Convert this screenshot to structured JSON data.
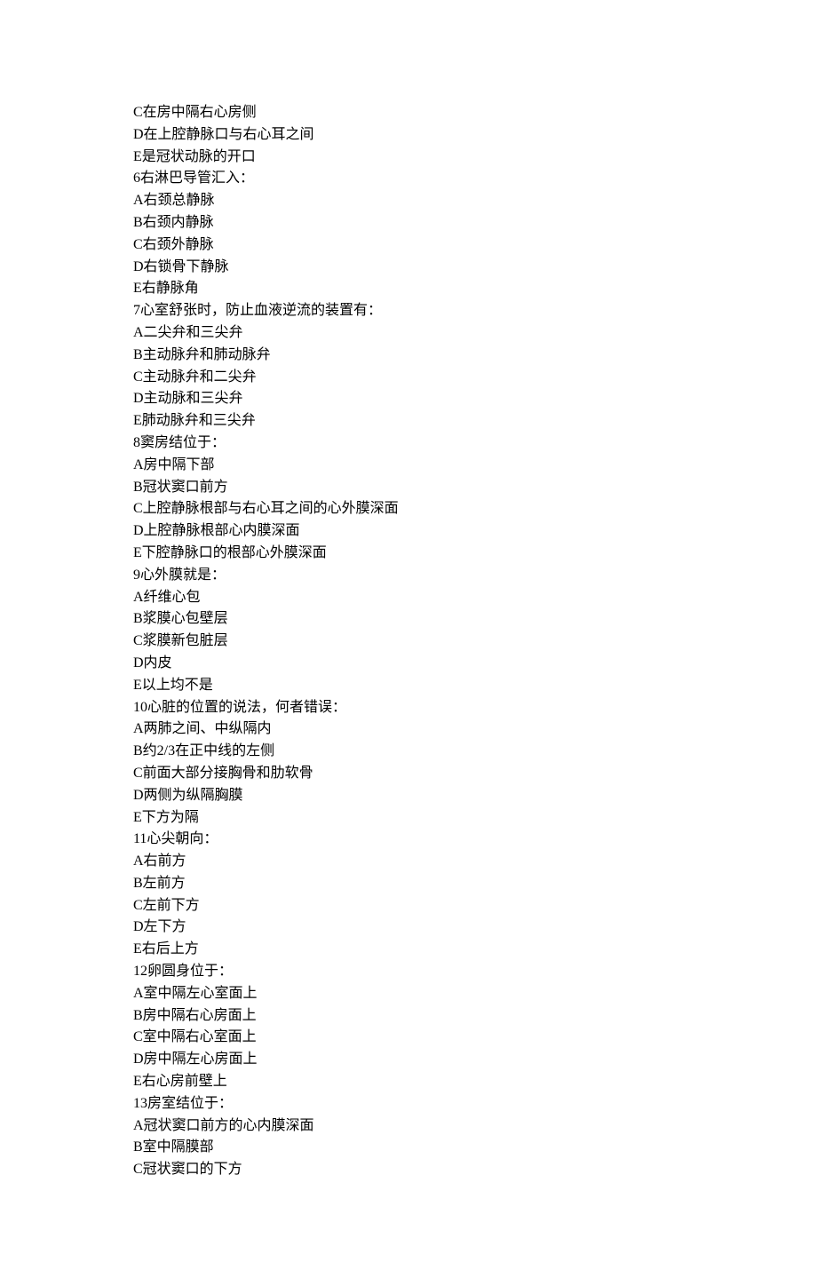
{
  "lines": [
    "C在房中隔右心房侧",
    "D在上腔静脉口与右心耳之间",
    "E是冠状动脉的开口",
    "6右淋巴导管汇入：",
    "A右颈总静脉",
    "B右颈内静脉",
    "C右颈外静脉",
    "D右锁骨下静脉",
    "E右静脉角",
    "7心室舒张时，防止血液逆流的装置有：",
    "A二尖弁和三尖弁",
    "B主动脉弁和肺动脉弁",
    "C主动脉弁和二尖弁",
    "D主动脉和三尖弁",
    "E肺动脉弁和三尖弁",
    "8窦房结位于：",
    "A房中隔下部",
    "B冠状窦口前方",
    "C上腔静脉根部与右心耳之间的心外膜深面",
    "D上腔静脉根部心内膜深面",
    "E下腔静脉口的根部心外膜深面",
    "9心外膜就是：",
    "A纤维心包",
    "B浆膜心包壁层",
    "C浆膜新包脏层",
    "D内皮",
    "E以上均不是",
    "10心脏的位置的说法，何者错误：",
    "A两肺之间、中纵隔内",
    "B约2/3在正中线的左侧",
    "C前面大部分接胸骨和肋软骨",
    "D两侧为纵隔胸膜",
    "E下方为隔",
    "11心尖朝向：",
    "A右前方",
    "B左前方",
    "C左前下方",
    "D左下方",
    "E右后上方",
    "12卵圆身位于：",
    "A室中隔左心室面上",
    "B房中隔右心房面上",
    "C室中隔右心室面上",
    "D房中隔左心房面上",
    "E右心房前壁上",
    "13房室结位于：",
    "A冠状窦口前方的心内膜深面",
    "B室中隔膜部",
    "C冠状窦口的下方"
  ]
}
